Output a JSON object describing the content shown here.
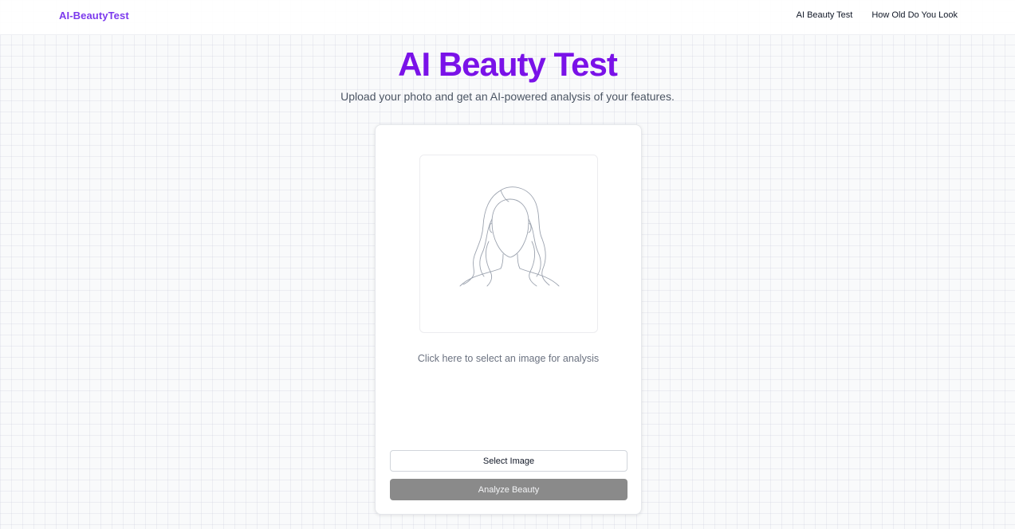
{
  "header": {
    "brand": "AI-BeautyTest",
    "nav": [
      {
        "label": "AI Beauty Test"
      },
      {
        "label": "How Old Do You Look"
      }
    ]
  },
  "hero": {
    "title": "AI Beauty Test",
    "subtitle": "Upload your photo and get an AI-powered analysis of your features."
  },
  "upload_card": {
    "placeholder_icon": "woman-silhouette-icon",
    "hint": "Click here to select an image for analysis",
    "select_button": "Select Image",
    "analyze_button": "Analyze Beauty",
    "analyze_enabled": false
  },
  "colors": {
    "brand": "#7c3aed",
    "title": "#7a12e8",
    "disabled_button": "#8a8a8a"
  }
}
